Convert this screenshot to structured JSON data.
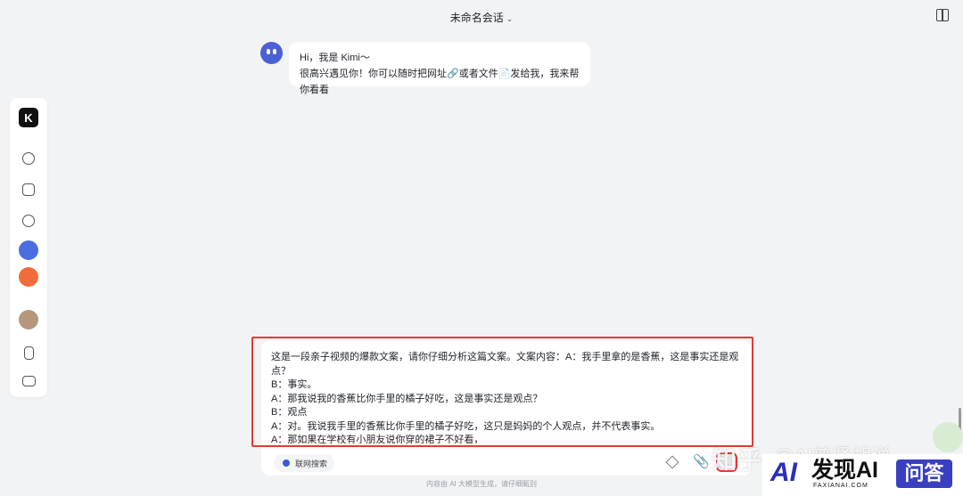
{
  "header": {
    "title": "未命名会话"
  },
  "chat": {
    "greeting": "Hi，我是 Kimi～",
    "message": "很高兴遇见你！你可以随时把网址🔗或者文件📄发给我，我来帮你看看"
  },
  "input": {
    "text": "这是一段亲子视频的爆款文案，请你仔细分析这篇文案。文案内容：A：我手里拿的是香蕉，这是事实还是观点？\nB：事实。\nA：那我说我的香蕉比你手里的橘子好吃，这是事实还是观点？\nB：观点\nA：对。我说我手里的香蕉比你手里的橘子好吃，这只是妈妈的个人观点，并不代表事实。\nA：那如果在学校有小朋友说你穿的裙子不好看，\nA：你的发型不好看，\nA：你的书包不好看，",
    "net_search_label": "联网搜索"
  },
  "footnote": "内容由 AI 大模型生成，请仔细甄别",
  "watermark": {
    "zhihu": "知乎",
    "handle": "@AI普贤胡说",
    "brand_logo": "AI",
    "brand_name": "发现AI",
    "brand_sub": "FAXIANAI.COM",
    "brand_qa": "问答"
  },
  "sidebar": {
    "logo": "K"
  },
  "colors": {
    "highlight": "#e53935",
    "brand_blue": "#3a3fc2",
    "background": "#f2f3f5"
  }
}
